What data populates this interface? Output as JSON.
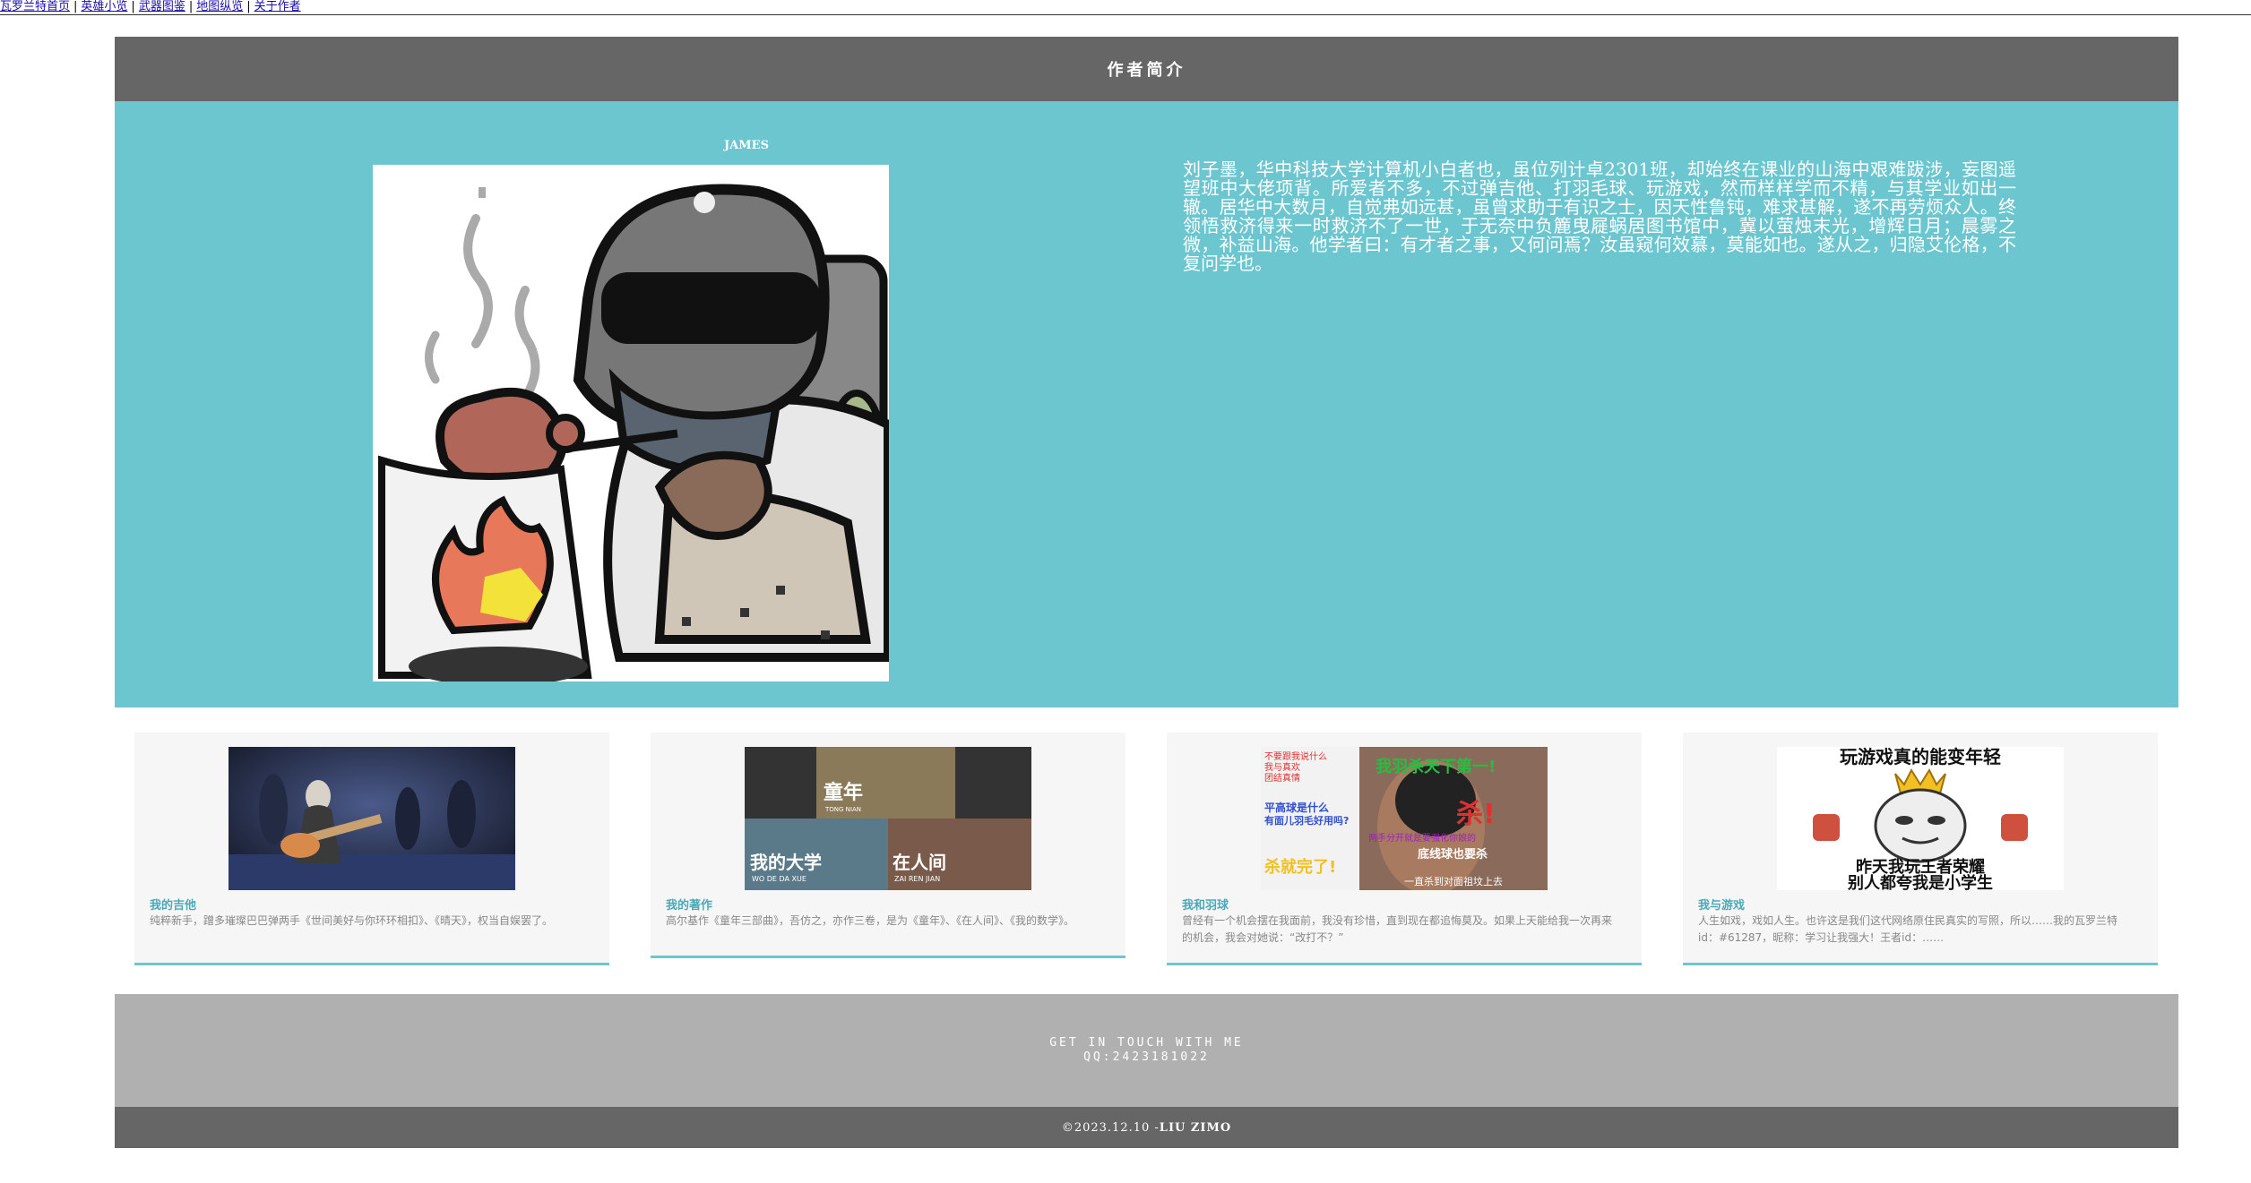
{
  "nav": {
    "items": [
      {
        "label": "瓦罗兰特首页"
      },
      {
        "label": "英雄小览"
      },
      {
        "label": "武器图鉴"
      },
      {
        "label": "地图纵览"
      },
      {
        "label": "关于作者"
      }
    ],
    "separator": "|"
  },
  "header": {
    "title": "作者简介"
  },
  "hero": {
    "name": "JAMES",
    "bio": "刘子墨，华中科技大学计算机小白者也，虽位列计卓2301班，却始终在课业的山海中艰难跋涉，妄图遥望班中大佬项背。所爱者不多，不过弹吉他、打羽毛球、玩游戏，然而样样学而不精，与其学业如出一辙。居华中大数月，自觉弗如远甚，虽曾求助于有识之士，因天性鲁钝，难求甚解，遂不再劳烦众人。终领悟救济得来一时救济不了一世，于无奈中负簏曳屣蜗居图书馆中，冀以萤烛末光，增辉日月；晨雾之微，补益山海。他学者曰：有才者之事，又何问焉？汝虽窥何效慕，莫能如也。遂从之，归隐艾伦格，不复问学也。"
  },
  "cards": [
    {
      "title": "我的吉他",
      "desc": "纯粹新手，蹭多璀璨巴巴弹两手《世间美好与你环环相扣》、《晴天》，权当自娱罢了。"
    },
    {
      "title": "我的著作",
      "desc": "高尔基作《童年三部曲》，吾仿之，亦作三卷，是为《童年》、《在人间》、《我的数学》。",
      "thumb_text": {
        "a": "童年",
        "a_sub": "TONG NIAN",
        "b": "我的大学",
        "b_sub": "WO DE DA XUE",
        "c": "在人间",
        "c_sub": "ZAI REN JIAN"
      }
    },
    {
      "title": "我和羽球",
      "desc": "曾经有一个机会摆在我面前，我没有珍惜，直到现在都追悔莫及。如果上天能给我一次再来的机会，我会对她说：“改打不？”",
      "thumb_text": {
        "l1": "不要跟我说什么",
        "l2": "我与真欢",
        "l3": "团结真情",
        "top": "我羽杀天下第一!",
        "mid": "平高球是什么",
        "mid2": "有面儿羽毛好用吗?",
        "kill": "杀!",
        "l4": "两手分开就是要强化你娘的",
        "l5": "底线球也要杀",
        "done": "杀就完了!",
        "end": "一直杀到对面祖坟上去"
      }
    },
    {
      "title": "我与游戏",
      "desc": "人生如戏，戏如人生。也许这是我们这代网络原住民真实的写照，所以……我的瓦罗兰特id：#61287，昵称：学习让我强大！王者id：……",
      "thumb_text": {
        "top": "玩游戏真的能变年轻",
        "b1": "昨天我玩王者荣耀",
        "b2": "别人都夸我是小学生"
      }
    }
  ],
  "contact": {
    "line1": "GET IN TOUCH WITH ME",
    "line2": "QQ:2423181022"
  },
  "footer": {
    "copyright": "©2023.12.10 - ",
    "author": "LIU ZIMO"
  }
}
